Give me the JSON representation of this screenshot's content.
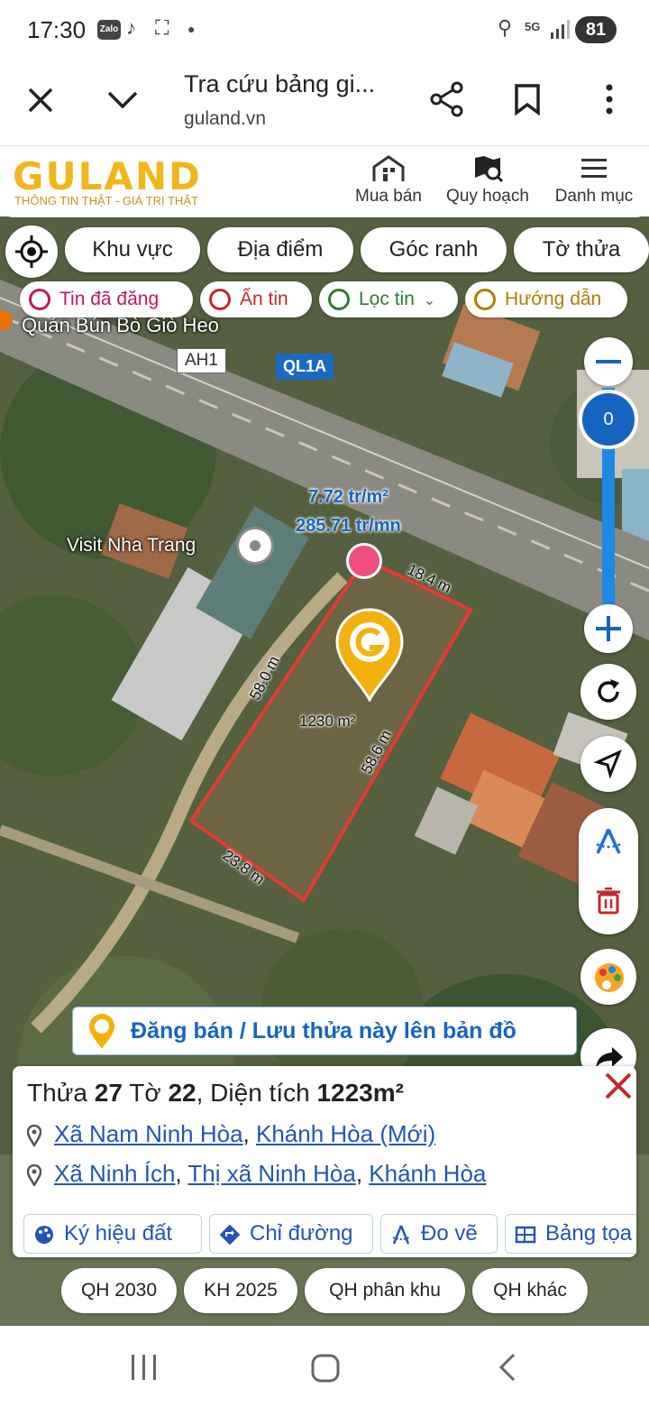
{
  "status_bar": {
    "time": "17:30",
    "zalo_label": "Zalo",
    "network": "5G",
    "battery": "81"
  },
  "browser": {
    "title": "Tra cứu bảng gi...",
    "url": "guland.vn"
  },
  "site_header": {
    "logo": "GULAND",
    "tagline": "THÔNG TIN THẬT - GIÁ TRỊ THẬT",
    "nav": [
      {
        "label": "Mua bán",
        "icon": "building-icon"
      },
      {
        "label": "Quy hoạch",
        "icon": "map-search-icon"
      },
      {
        "label": "Danh mục",
        "icon": "menu-icon"
      }
    ]
  },
  "search_chips": [
    "Khu vực",
    "Địa điểm",
    "Góc ranh",
    "Tờ thửa"
  ],
  "filter_chips": [
    {
      "label": "Tin đã đăng",
      "color": "#c2185b"
    },
    {
      "label": "Ẩn tin",
      "color": "#c62828"
    },
    {
      "label": "Lọc tin",
      "color": "#2e7d32"
    },
    {
      "label": "Hướng dẫn",
      "color": "#b07d00"
    }
  ],
  "map": {
    "poi_top": "Quán Bún Bò Giò Heo",
    "road_badge_1": "AH1",
    "road_badge_2": "QL1A",
    "poi_visit": "Visit Nha Trang",
    "price_per_m2": "7.72 tr/m²",
    "price_per_mn": "285.71 tr/mn",
    "edge_top": "18.4 m",
    "edge_left": "58.0 m",
    "edge_right": "58.6 m",
    "edge_bottom": "23.8 m",
    "area_label": "1230 m²",
    "zoom_level": "0",
    "accent": "#1565c0",
    "parcel_color": "#e53935"
  },
  "banner": {
    "label": "Đăng bán / Lưu thửa này lên bản đồ"
  },
  "info_card": {
    "parcel_prefix": "Thửa ",
    "parcel_no": "27",
    "sheet_prefix": " Tờ ",
    "sheet_no": "22",
    "area_prefix": ", Diện tích ",
    "area_value": "1223m²",
    "address_new": {
      "commune": "Xã Nam Ninh Hòa",
      "province": "Khánh Hòa (Mới)"
    },
    "address_old": {
      "commune": "Xã Ninh Ích",
      "district": "Thị xã Ninh Hòa",
      "province": "Khánh Hòa"
    },
    "actions": [
      {
        "label": "Ký hiệu đất",
        "icon": "palette-icon"
      },
      {
        "label": "Chỉ đường",
        "icon": "directions-icon"
      },
      {
        "label": "Đo vẽ",
        "icon": "measure-icon"
      },
      {
        "label": "Bảng tọa",
        "icon": "table-icon"
      }
    ]
  },
  "plan_chips": [
    "QH 2030",
    "KH 2025",
    "QH phân khu",
    "QH khác"
  ]
}
